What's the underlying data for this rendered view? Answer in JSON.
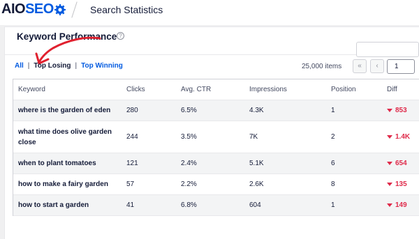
{
  "header": {
    "logo_prefix": "AIO",
    "logo_suffix": "SEO",
    "page_title": "Search Statistics"
  },
  "panel": {
    "title": "Keyword Performance",
    "help": "?"
  },
  "filters": {
    "all": "All",
    "sep": "|",
    "top_losing": "Top Losing",
    "top_winning": "Top Winning"
  },
  "pagination": {
    "items": "25,000 items",
    "first": "«",
    "prev": "‹",
    "page": "1"
  },
  "table": {
    "headers": [
      "Keyword",
      "Clicks",
      "Avg. CTR",
      "Impressions",
      "Position",
      "Diff"
    ],
    "rows": [
      {
        "keyword": "where is the garden of eden",
        "clicks": "280",
        "ctr": "6.5%",
        "impressions": "4.3K",
        "position": "1",
        "diff": "853"
      },
      {
        "keyword": "what time does olive garden close",
        "clicks": "244",
        "ctr": "3.5%",
        "impressions": "7K",
        "position": "2",
        "diff": "1.4K"
      },
      {
        "keyword": "when to plant tomatoes",
        "clicks": "121",
        "ctr": "2.4%",
        "impressions": "5.1K",
        "position": "6",
        "diff": "654"
      },
      {
        "keyword": "how to make a fairy garden",
        "clicks": "57",
        "ctr": "2.2%",
        "impressions": "2.6K",
        "position": "8",
        "diff": "135"
      },
      {
        "keyword": "how to start a garden",
        "clicks": "41",
        "ctr": "6.8%",
        "impressions": "604",
        "position": "1",
        "diff": "149"
      }
    ]
  },
  "colors": {
    "accent": "#005ae0",
    "negative": "#df2a4a",
    "annotation": "#e0212f"
  },
  "icons": [
    "gear-icon",
    "help-icon",
    "arrow-annotation-icon",
    "down-triangle-icon"
  ]
}
